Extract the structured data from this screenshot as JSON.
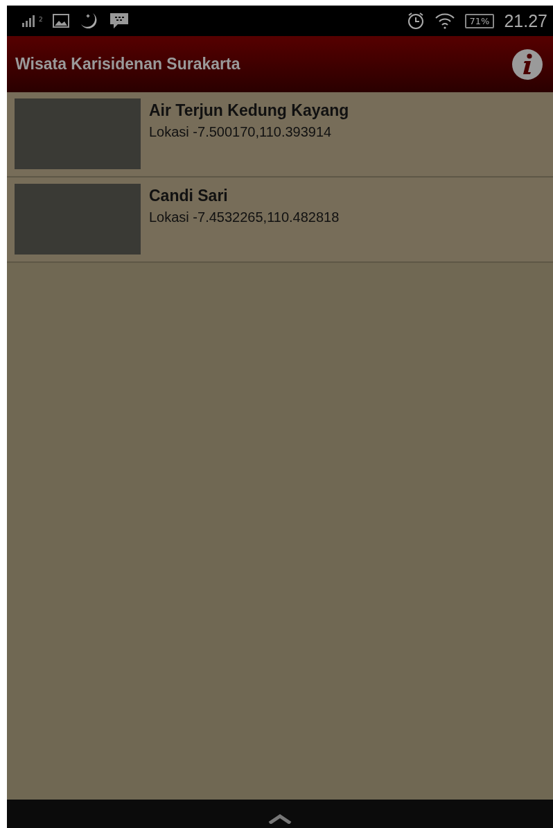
{
  "status_bar": {
    "signal_sub": "2",
    "battery": "71%",
    "time": "21.27"
  },
  "app_bar": {
    "title": "Wisata Karisidenan Surakarta"
  },
  "places": [
    {
      "name": "Air Terjun Kedung Kayang",
      "location": "Lokasi -7.500170,110.393914"
    },
    {
      "name": "Candi Sari",
      "location": "Lokasi -7.4532265,110.482818"
    }
  ]
}
